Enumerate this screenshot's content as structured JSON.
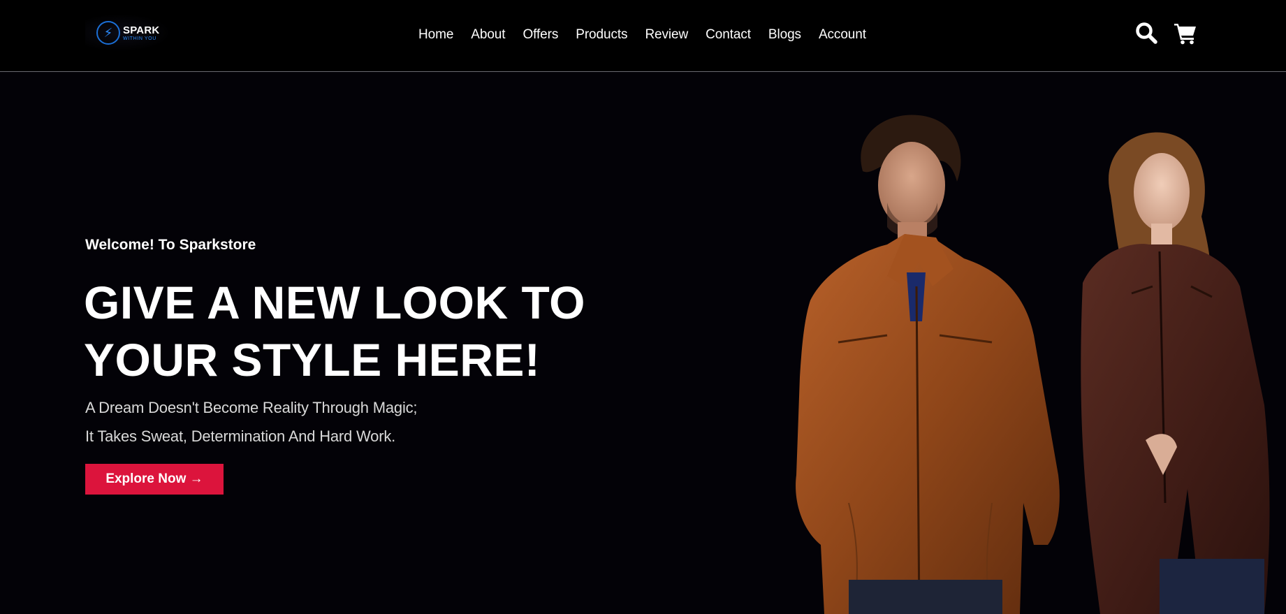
{
  "header": {
    "logo": {
      "name": "SPARK",
      "tagline": "WITHIN YOU",
      "icon": "lightning-bolt-icon"
    },
    "nav": [
      {
        "label": "Home"
      },
      {
        "label": "About"
      },
      {
        "label": "Offers"
      },
      {
        "label": "Products"
      },
      {
        "label": "Review"
      },
      {
        "label": "Contact"
      },
      {
        "label": "Blogs"
      },
      {
        "label": "Account"
      }
    ],
    "icons": {
      "search": "search-icon",
      "cart": "cart-icon"
    }
  },
  "hero": {
    "welcome": "Welcome! To Sparkstore",
    "headline_line1": "GIVE A NEW LOOK TO",
    "headline_line2": "YOUR STYLE HERE!",
    "subtext_line1": "A Dream Doesn't Become Reality Through Magic;",
    "subtext_line2": "It Takes Sweat, Determination And Hard Work.",
    "cta_label": "Explore Now →",
    "image": "models-in-leather-jackets"
  },
  "colors": {
    "background": "#030207",
    "accent": "#dc143c",
    "brand_blue": "#2a8cff",
    "text": "#ffffff"
  }
}
